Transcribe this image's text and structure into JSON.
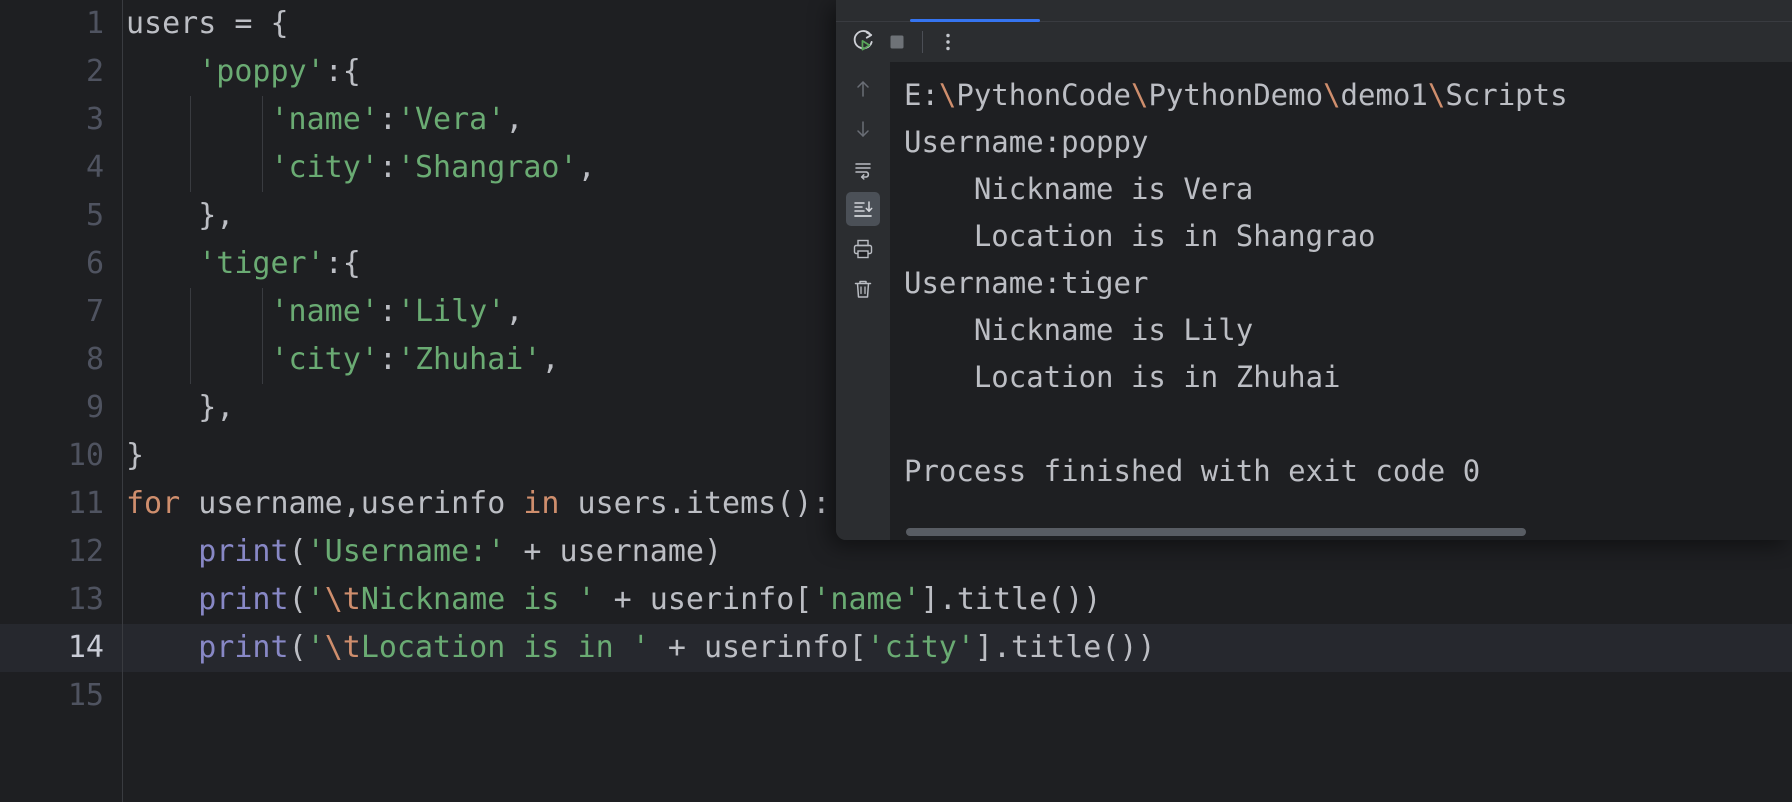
{
  "editor": {
    "name": "python-code-editor",
    "current_line": 14,
    "lines": [
      {
        "num": "1",
        "tokens": [
          {
            "t": "plain",
            "v": "users = {"
          }
        ]
      },
      {
        "num": "2",
        "tokens": [
          {
            "t": "plain",
            "v": "    "
          },
          {
            "t": "str",
            "v": "'poppy'"
          },
          {
            "t": "plain",
            "v": ":{"
          }
        ]
      },
      {
        "num": "3",
        "tokens": [
          {
            "t": "plain",
            "v": "        "
          },
          {
            "t": "str",
            "v": "'name'"
          },
          {
            "t": "plain",
            "v": ":"
          },
          {
            "t": "str",
            "v": "'Vera'"
          },
          {
            "t": "plain",
            "v": ","
          }
        ]
      },
      {
        "num": "4",
        "tokens": [
          {
            "t": "plain",
            "v": "        "
          },
          {
            "t": "str",
            "v": "'city'"
          },
          {
            "t": "plain",
            "v": ":"
          },
          {
            "t": "str",
            "v": "'Shangrao'"
          },
          {
            "t": "plain",
            "v": ","
          }
        ]
      },
      {
        "num": "5",
        "tokens": [
          {
            "t": "plain",
            "v": "    },"
          }
        ]
      },
      {
        "num": "6",
        "tokens": [
          {
            "t": "plain",
            "v": "    "
          },
          {
            "t": "str",
            "v": "'tiger'"
          },
          {
            "t": "plain",
            "v": ":{"
          }
        ]
      },
      {
        "num": "7",
        "tokens": [
          {
            "t": "plain",
            "v": "        "
          },
          {
            "t": "str",
            "v": "'name'"
          },
          {
            "t": "plain",
            "v": ":"
          },
          {
            "t": "str",
            "v": "'Lily'"
          },
          {
            "t": "plain",
            "v": ","
          }
        ]
      },
      {
        "num": "8",
        "tokens": [
          {
            "t": "plain",
            "v": "        "
          },
          {
            "t": "str",
            "v": "'city'"
          },
          {
            "t": "plain",
            "v": ":"
          },
          {
            "t": "str",
            "v": "'Zhuhai'"
          },
          {
            "t": "plain",
            "v": ","
          }
        ]
      },
      {
        "num": "9",
        "tokens": [
          {
            "t": "plain",
            "v": "    },"
          }
        ]
      },
      {
        "num": "10",
        "tokens": [
          {
            "t": "plain",
            "v": "}"
          }
        ]
      },
      {
        "num": "11",
        "tokens": [
          {
            "t": "kw",
            "v": "for"
          },
          {
            "t": "plain",
            "v": " username,userinfo "
          },
          {
            "t": "kw",
            "v": "in"
          },
          {
            "t": "plain",
            "v": " users.items():"
          }
        ]
      },
      {
        "num": "12",
        "tokens": [
          {
            "t": "plain",
            "v": "    "
          },
          {
            "t": "fn",
            "v": "print"
          },
          {
            "t": "plain",
            "v": "("
          },
          {
            "t": "str",
            "v": "'Username:'"
          },
          {
            "t": "plain",
            "v": " + username)"
          }
        ]
      },
      {
        "num": "13",
        "tokens": [
          {
            "t": "plain",
            "v": "    "
          },
          {
            "t": "fn",
            "v": "print"
          },
          {
            "t": "plain",
            "v": "("
          },
          {
            "t": "str",
            "v": "'"
          },
          {
            "t": "esc",
            "v": "\\t"
          },
          {
            "t": "str",
            "v": "Nickname is '"
          },
          {
            "t": "plain",
            "v": " + userinfo["
          },
          {
            "t": "str",
            "v": "'name'"
          },
          {
            "t": "plain",
            "v": "].title())"
          }
        ]
      },
      {
        "num": "14",
        "tokens": [
          {
            "t": "plain",
            "v": "    "
          },
          {
            "t": "fn",
            "v": "print"
          },
          {
            "t": "plain",
            "v": "("
          },
          {
            "t": "str",
            "v": "'"
          },
          {
            "t": "esc",
            "v": "\\t"
          },
          {
            "t": "str",
            "v": "Location is in '"
          },
          {
            "t": "plain",
            "v": " + userinfo["
          },
          {
            "t": "str",
            "v": "'city'"
          },
          {
            "t": "plain",
            "v": "].title())"
          }
        ]
      },
      {
        "num": "15",
        "tokens": [
          {
            "t": "plain",
            "v": ""
          }
        ]
      }
    ]
  },
  "console": {
    "toolbar": {
      "rerun_label": "rerun-icon",
      "stop_label": "stop-icon",
      "more_label": "more-options-icon"
    },
    "gutter_icons": [
      {
        "name": "up-arrow-icon",
        "active": false
      },
      {
        "name": "down-arrow-icon",
        "active": false
      },
      {
        "name": "soft-wrap-icon",
        "active": false
      },
      {
        "name": "scroll-to-end-icon",
        "active": true
      },
      {
        "name": "print-icon",
        "active": false
      },
      {
        "name": "trash-icon",
        "active": false
      }
    ],
    "output_lines": [
      "E:\\PythonCode\\PythonDemo\\demo1\\Scripts",
      "Username:poppy",
      "    Nickname is Vera",
      "    Location is in Shangrao",
      "Username:tiger",
      "    Nickname is Lily",
      "    Location is in Zhuhai",
      "",
      "Process finished with exit code 0"
    ]
  },
  "colors": {
    "accent": "#3574f0",
    "string": "#6aab73",
    "keyword": "#cf8e6d",
    "function": "#8888c6",
    "plain": "#bcbec4",
    "editor_bg": "#1e1f22",
    "panel_bg": "#2b2d30"
  }
}
